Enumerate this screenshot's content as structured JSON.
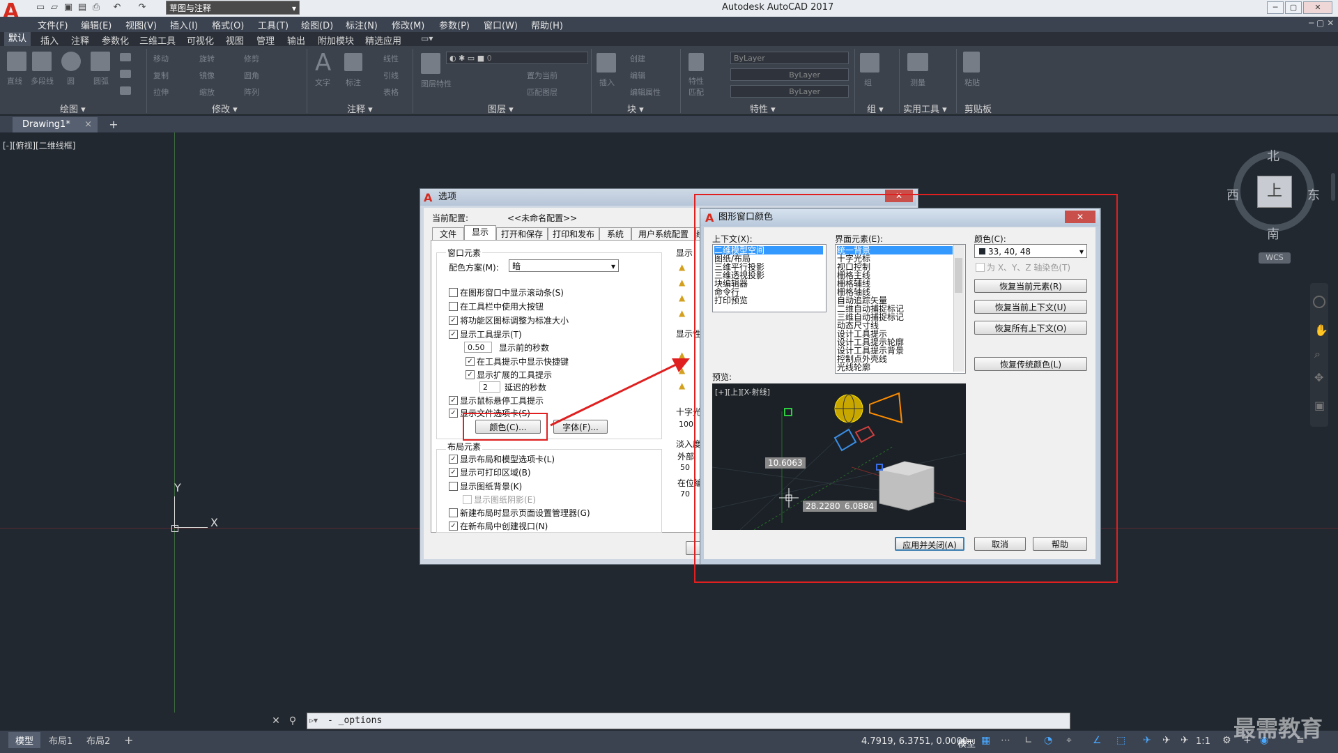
{
  "app": {
    "title": "Autodesk AutoCAD 2017",
    "workspace": "草图与注释",
    "logo": "A",
    "quick_access_icons": [
      "new-icon",
      "open-icon",
      "save-icon",
      "save-as-icon",
      "plot-icon",
      "undo-icon",
      "redo-icon"
    ]
  },
  "menus": [
    "文件(F)",
    "编辑(E)",
    "视图(V)",
    "插入(I)",
    "格式(O)",
    "工具(T)",
    "绘图(D)",
    "标注(N)",
    "修改(M)",
    "参数(P)",
    "窗口(W)",
    "帮助(H)"
  ],
  "ribbon_tabs": [
    "默认",
    "插入",
    "注释",
    "参数化",
    "三维工具",
    "可视化",
    "视图",
    "管理",
    "输出",
    "附加模块",
    "精选应用"
  ],
  "ribbon_panels": [
    "绘图 ▾",
    "修改 ▾",
    "注释 ▾",
    "图层 ▾",
    "块 ▾",
    "特性 ▾",
    "组 ▾",
    "实用工具 ▾",
    "剪贴板"
  ],
  "ribbon_tools": {
    "draw": [
      "直线",
      "多段线",
      "圆",
      "圆弧"
    ],
    "modify": [
      "移动",
      "旋转",
      "修剪",
      "复制",
      "镜像",
      "圆角",
      "拉伸",
      "缩放",
      "阵列"
    ],
    "annotate": [
      "文字",
      "标注",
      "线性",
      "引线",
      "表格"
    ],
    "layer": [
      "图层特性",
      "置为当前",
      "匹配图层"
    ],
    "layer_current": "0",
    "block": [
      "插入",
      "创建",
      "编辑",
      "编辑属性"
    ],
    "properties": [
      "ByLayer",
      "ByLayer",
      "ByLayer"
    ],
    "properties_labels": [
      "特性",
      "匹配"
    ],
    "groups": [
      "组"
    ],
    "utilities": [
      "测量"
    ],
    "clipboard": [
      "粘贴"
    ]
  },
  "doc_tab": "Drawing1*",
  "view_label": "[-][俯视][二维线框]",
  "ucs": {
    "x": "X",
    "y": "Y"
  },
  "viewcube": {
    "north": "北",
    "south": "南",
    "east": "东",
    "west": "西",
    "face": "上",
    "wcs": "WCS"
  },
  "command_line": {
    "text": "- _options"
  },
  "layout_tabs": [
    "模型",
    "布局1",
    "布局2"
  ],
  "status": {
    "coords": "4.7919, 6.3751, 0.0000",
    "mode": "模型",
    "scale": "1:1"
  },
  "options_dialog": {
    "title": "选项",
    "current_profile_label": "当前配置:",
    "current_profile_value": "<<未命名配置>>",
    "tabs": [
      "文件",
      "显示",
      "打开和保存",
      "打印和发布",
      "系统",
      "用户系统配置",
      "绘"
    ],
    "window_elements_title": "窗口元素",
    "color_scheme_label": "配色方案(M):",
    "color_scheme_value": "暗",
    "checks": [
      {
        "label": "在图形窗口中显示滚动条(S)",
        "checked": false
      },
      {
        "label": "在工具栏中使用大按钮",
        "checked": false
      },
      {
        "label": "将功能区图标调整为标准大小",
        "checked": true
      },
      {
        "label": "显示工具提示(T)",
        "checked": true
      }
    ],
    "tooltip_delay": "0.50",
    "tooltip_delay_label": "显示前的秒数",
    "sub_checks": [
      {
        "label": "在工具提示中显示快捷键",
        "checked": true
      },
      {
        "label": "显示扩展的工具提示",
        "checked": true
      }
    ],
    "ext_delay": "2",
    "ext_delay_label": "延迟的秒数",
    "checks2": [
      {
        "label": "显示鼠标悬停工具提示",
        "checked": true
      },
      {
        "label": "显示文件选项卡(S)",
        "checked": true
      }
    ],
    "color_button": "颜色(C)...",
    "font_button": "字体(F)...",
    "layout_elements_title": "布局元素",
    "layout_checks": [
      {
        "label": "显示布局和模型选项卡(L)",
        "checked": true
      },
      {
        "label": "显示可打印区域(B)",
        "checked": true
      },
      {
        "label": "显示图纸背景(K)",
        "checked": false
      },
      {
        "label": "显示图纸阴影(E)",
        "checked": false
      },
      {
        "label": "新建布局时显示页面设置管理器(G)",
        "checked": false
      },
      {
        "label": "在新布局中创建视口(N)",
        "checked": true
      }
    ],
    "right_col": [
      "显示",
      "显示性",
      "十字光",
      "100",
      "淡入度",
      "外部",
      "50",
      "在位编",
      "70"
    ]
  },
  "color_dialog": {
    "title": "图形窗口颜色",
    "context_label": "上下文(X):",
    "contexts": [
      "二维模型空间",
      "图纸/布局",
      "三维平行投影",
      "三维透视投影",
      "块编辑器",
      "命令行",
      "打印预览"
    ],
    "elements_label": "界面元素(E):",
    "elements": [
      "统一背景",
      "十字光标",
      "视口控制",
      "栅格主线",
      "栅格辅线",
      "栅格轴线",
      "自动追踪矢量",
      "二维自动捕捉标记",
      "三维自动捕捉标记",
      "动态尺寸线",
      "设计工具提示",
      "设计工具提示轮廓",
      "设计工具提示背景",
      "控制点外壳线",
      "光线轮廓"
    ],
    "color_label": "颜色(C):",
    "color_value": "33, 40, 48",
    "tint_label": "为 X、Y、Z 轴染色(T)",
    "buttons": [
      "恢复当前元素(R)",
      "恢复当前上下文(U)",
      "恢复所有上下文(O)",
      "恢复传统颜色(L)"
    ],
    "preview_label": "预览:",
    "preview_view": "[+][上][X-射线]",
    "preview_dims": [
      "10.6063",
      "28.2280",
      "6.0884"
    ],
    "bottom_buttons": [
      "应用并关闭(A)",
      "取消",
      "帮助"
    ]
  },
  "watermark": "最需教育",
  "colors": {
    "canvas": "#212830",
    "accent_red": "#e02020",
    "selection": "#3399ff"
  }
}
